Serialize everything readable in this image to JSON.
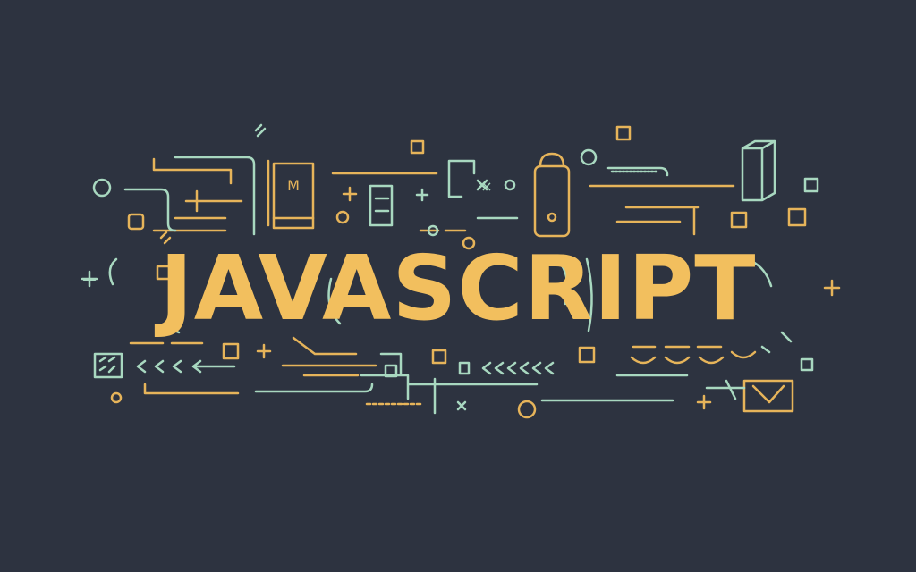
{
  "headline": "JAVASCRIPT",
  "colors": {
    "background": "#2d3340",
    "headline": "#f2bf5e",
    "accent_yellow": "#e6b45a",
    "accent_mint": "#a8d8c0"
  },
  "decor_glyphs": {
    "m_glyph": "M",
    "x_glyph": "×",
    "plus_glyph": "+"
  }
}
